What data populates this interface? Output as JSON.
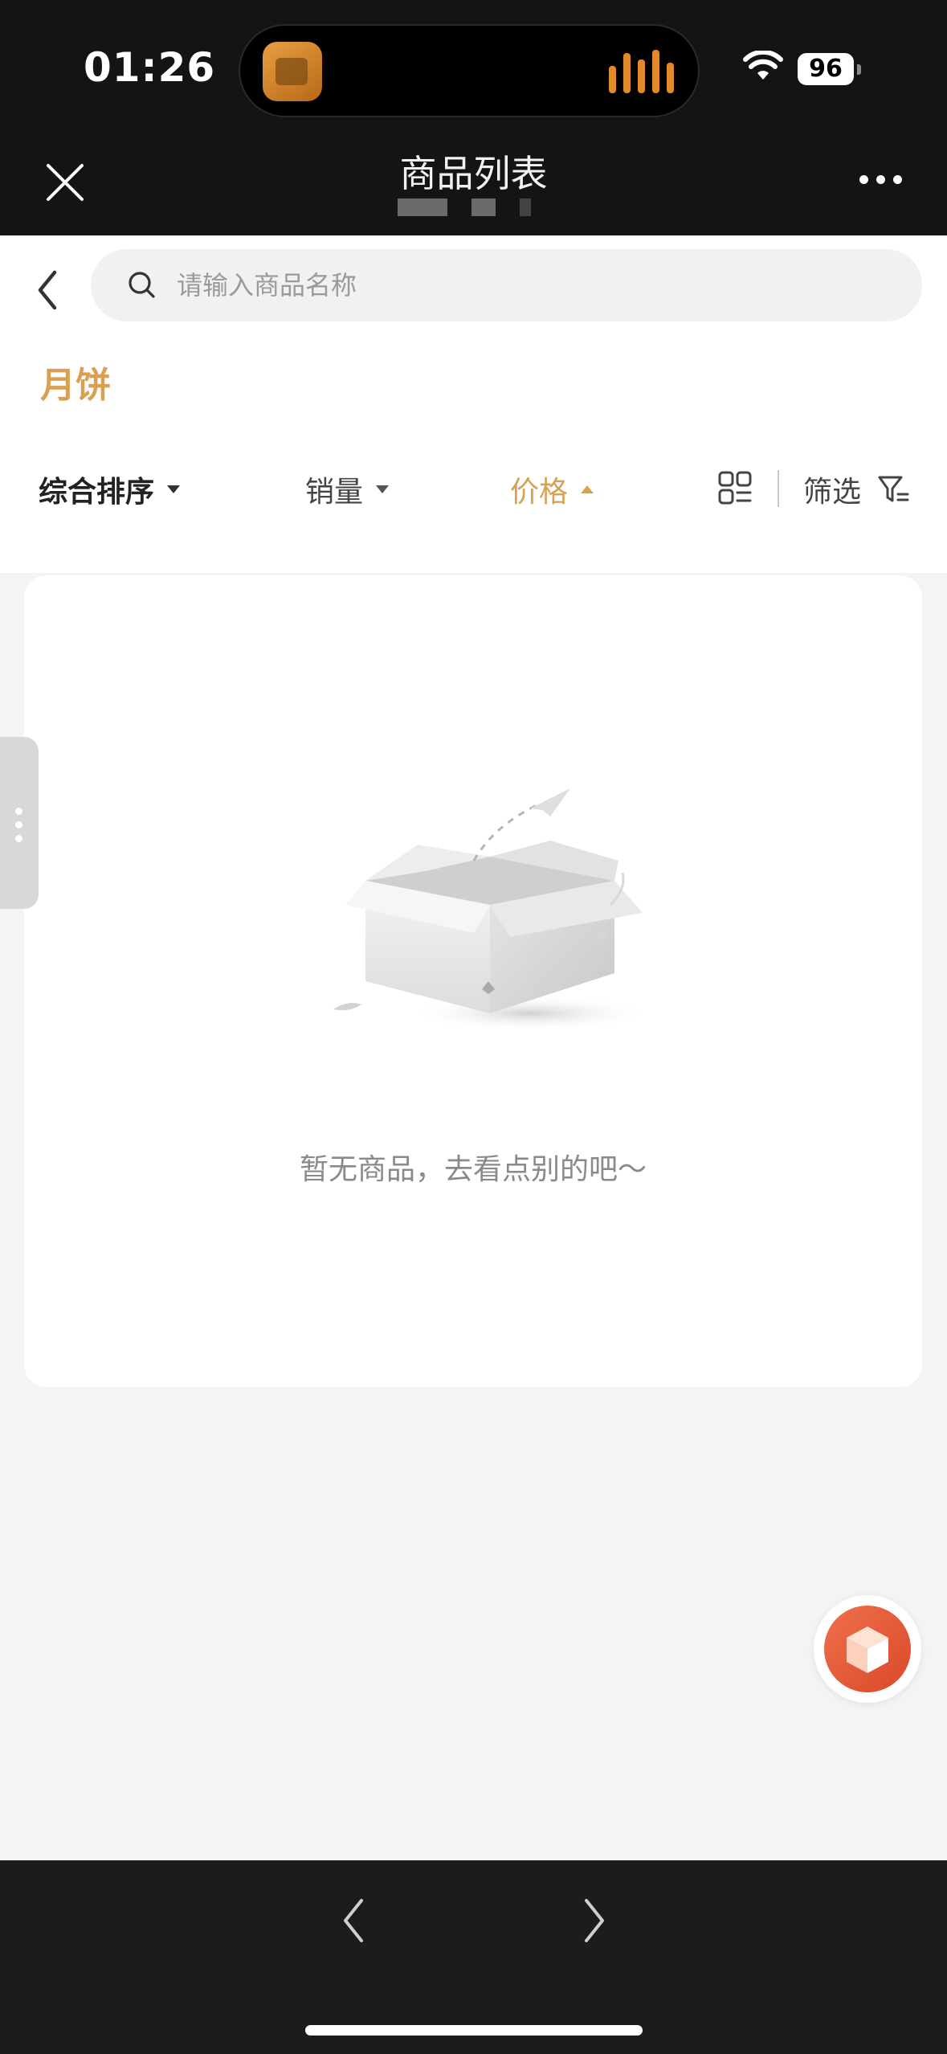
{
  "status_bar": {
    "time": "01:26",
    "battery": "96"
  },
  "header": {
    "title": "商品列表"
  },
  "search": {
    "placeholder": "请输入商品名称"
  },
  "category": "月饼",
  "sort_bar": {
    "comprehensive": "综合排序",
    "sales": "销量",
    "price": "价格",
    "filter": "筛选",
    "active_sort": "price",
    "price_direction": "ascending"
  },
  "empty_state": {
    "message": "暂无商品，去看点别的吧～"
  },
  "colors": {
    "accent": "#d9a054",
    "header_bg": "#141414",
    "page_bg": "#f4f4f4",
    "float_button": "#e45a38"
  }
}
